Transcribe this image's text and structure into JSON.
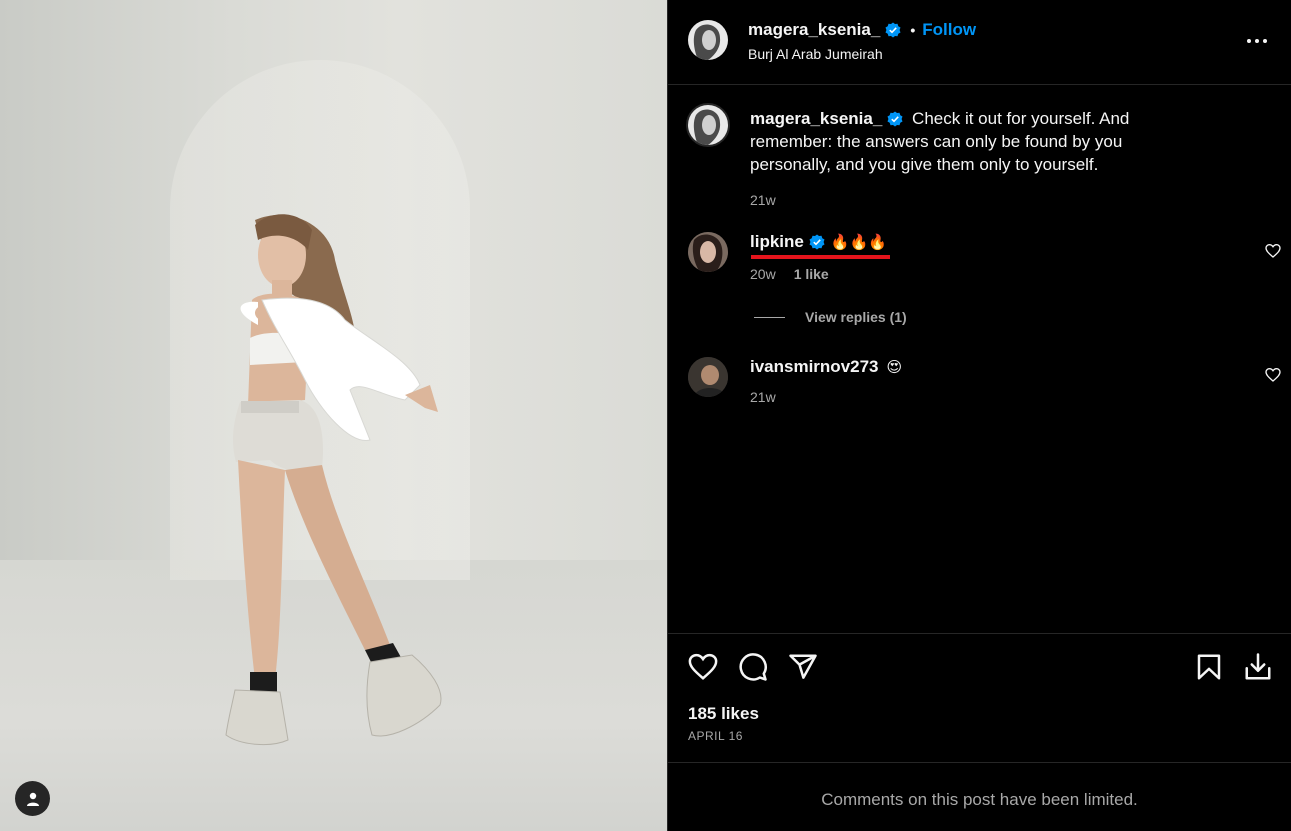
{
  "post": {
    "author": "magera_ksenia_",
    "location": "Burj Al Arab Jumeirah",
    "follow_label": "Follow",
    "dot": "•"
  },
  "caption": {
    "user": "magera_ksenia_",
    "text": "Check it out for yourself. And remember: the answers can only be found by you personally, and you give them only to yourself.",
    "time": "21w"
  },
  "comments": [
    {
      "user": "lipkine",
      "verified": true,
      "text": "🔥🔥🔥",
      "time": "20w",
      "likes": "1 like",
      "view_replies": "View replies (1)"
    },
    {
      "user": "ivansmirnov273",
      "verified": false,
      "text": "😍",
      "time": "21w"
    }
  ],
  "footer": {
    "likes": "185 likes",
    "date": "APRIL 16",
    "limited_notice": "Comments on this post have been limited."
  },
  "icons": {
    "like": "heart-icon",
    "comment": "comment-icon",
    "share": "send-icon",
    "save": "bookmark-icon",
    "download": "download-icon",
    "more": "more-icon",
    "verified": "verified-badge-icon",
    "profile": "person-icon"
  },
  "colors": {
    "accent": "#0095f6",
    "highlight_underline": "#e5141c",
    "muted_text": "#a8a8a8",
    "background": "#000000"
  }
}
